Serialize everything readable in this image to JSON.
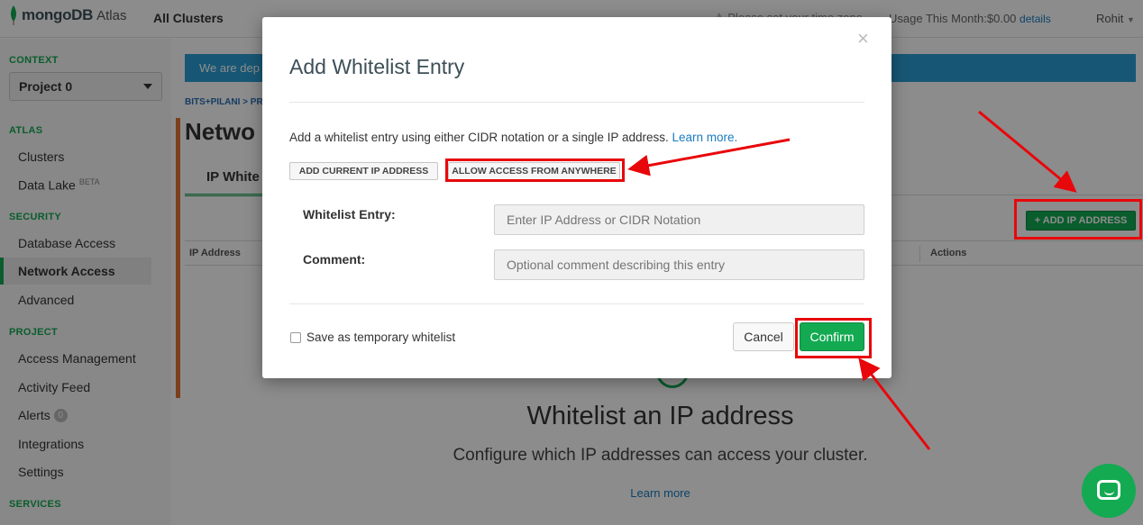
{
  "topbar": {
    "brand": "mongoDB",
    "product": "Atlas",
    "all_clusters": "All Clusters",
    "timezone_notice": "Please set your time zone",
    "usage_label": "Usage This Month:",
    "usage_value": "$0.00",
    "usage_details": "details",
    "user": "Rohit"
  },
  "sidebar": {
    "context_heading": "CONTEXT",
    "project_select": "Project 0",
    "atlas_heading": "ATLAS",
    "clusters": "Clusters",
    "data_lake": "Data Lake",
    "data_lake_badge": "BETA",
    "security_heading": "SECURITY",
    "database_access": "Database Access",
    "network_access": "Network Access",
    "advanced": "Advanced",
    "project_heading": "PROJECT",
    "access_management": "Access Management",
    "activity_feed": "Activity Feed",
    "alerts": "Alerts",
    "alerts_count": "0",
    "integrations": "Integrations",
    "settings": "Settings",
    "services_heading": "SERVICES"
  },
  "main": {
    "banner_text": "We are dep",
    "breadcrumb": "BITS+PILANI > PR",
    "page_title": "Netwo",
    "tab_ip_whitelist": "IP White",
    "col_ip_address": "IP Address",
    "col_actions": "Actions",
    "add_ip_button": "+ ADD IP ADDRESS",
    "empty_title": "Whitelist an IP address",
    "empty_subtitle": "Configure which IP addresses can access your cluster.",
    "empty_link": "Learn more"
  },
  "modal": {
    "title": "Add Whitelist Entry",
    "close_glyph": "×",
    "description": "Add a whitelist entry using either CIDR notation or a single IP address.",
    "learn_more": "Learn more.",
    "add_current_ip": "ADD CURRENT IP ADDRESS",
    "allow_anywhere": "ALLOW ACCESS FROM ANYWHERE",
    "whitelist_entry_label": "Whitelist Entry:",
    "whitelist_entry_placeholder": "Enter IP Address or CIDR Notation",
    "comment_label": "Comment:",
    "comment_placeholder": "Optional comment describing this entry",
    "temporary_label": "Save as temporary whitelist",
    "cancel": "Cancel",
    "confirm": "Confirm"
  },
  "colors": {
    "accent_green": "#13aa52",
    "annotation_red": "#e8070b",
    "link_blue": "#1a7bbf",
    "banner_blue": "#2a9fd6"
  },
  "icons": {
    "logo": "mongodb-leaf-icon",
    "dropdown": "chevron-down-icon",
    "close": "close-icon",
    "chat": "chat-icon",
    "warning": "warning-icon"
  }
}
